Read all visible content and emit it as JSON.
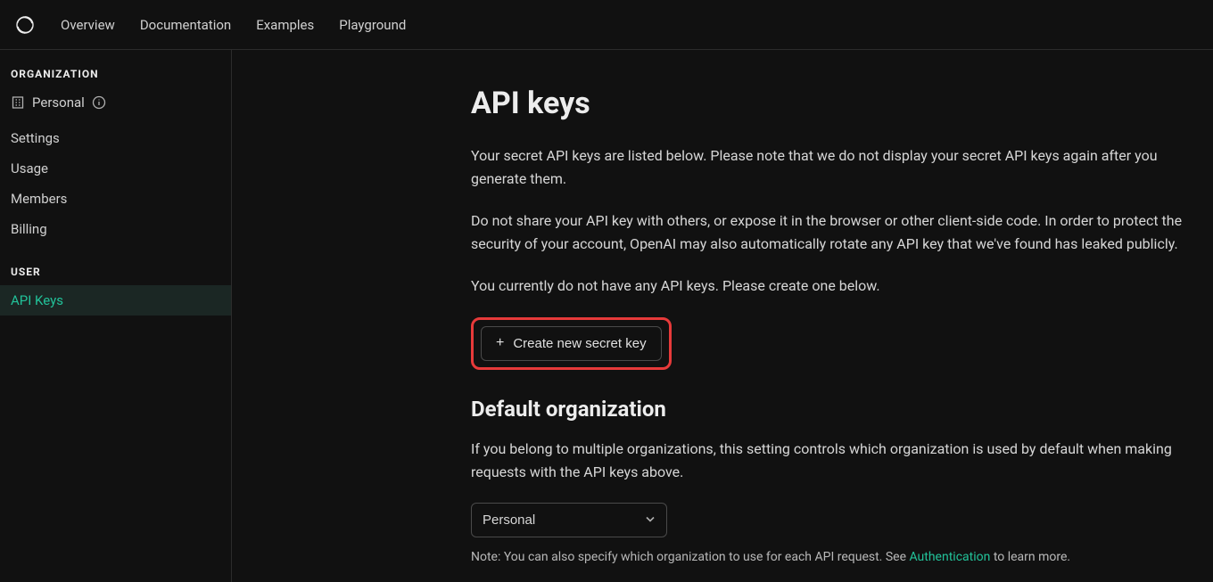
{
  "topnav": {
    "links": [
      "Overview",
      "Documentation",
      "Examples",
      "Playground"
    ]
  },
  "sidebar": {
    "org_heading": "ORGANIZATION",
    "org_name": "Personal",
    "org_items": [
      "Settings",
      "Usage",
      "Members",
      "Billing"
    ],
    "user_heading": "USER",
    "user_items": [
      "API Keys"
    ],
    "active_user_item": "API Keys"
  },
  "main": {
    "title": "API keys",
    "para1": "Your secret API keys are listed below. Please note that we do not display your secret API keys again after you generate them.",
    "para2": "Do not share your API key with others, or expose it in the browser or other client-side code. In order to protect the security of your account, OpenAI may also automatically rotate any API key that we've found has leaked publicly.",
    "para3": "You currently do not have any API keys. Please create one below.",
    "create_button": "Create new secret key",
    "default_org_heading": "Default organization",
    "default_org_para": "If you belong to multiple organizations, this setting controls which organization is used by default when making requests with the API keys above.",
    "select_value": "Personal",
    "note_prefix": "Note: You can also specify which organization to use for each API request. See ",
    "note_link": "Authentication",
    "note_suffix": " to learn more."
  }
}
